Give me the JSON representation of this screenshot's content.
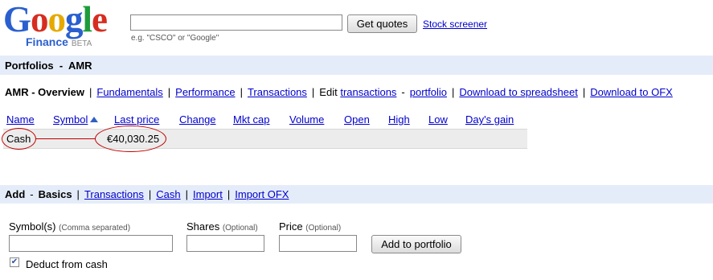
{
  "logo": {
    "letters": [
      "G",
      "o",
      "o",
      "g",
      "l",
      "e"
    ],
    "product": "Finance",
    "badge": "BETA"
  },
  "search": {
    "value": "",
    "hint": "e.g. \"CSCO\" or \"Google\"",
    "button": "Get quotes",
    "screener_link": "Stock screener"
  },
  "portfolio_bar": {
    "title": "Portfolios  -  AMR"
  },
  "overview_nav": {
    "current": "AMR - Overview",
    "fundamentals": "Fundamentals",
    "performance": "Performance",
    "transactions": "Transactions",
    "edit_prefix": "Edit",
    "edit_transactions": "transactions",
    "edit_dash": "-",
    "edit_portfolio": "portfolio",
    "download_spreadsheet": "Download to spreadsheet",
    "download_ofx": "Download to OFX",
    "separator": "|"
  },
  "table": {
    "headers": [
      "Name",
      "Symbol",
      "Last price",
      "Change",
      "Mkt cap",
      "Volume",
      "Open",
      "High",
      "Low",
      "Day's gain"
    ],
    "sort_icon": "triangle-up-icon",
    "rows": [
      {
        "name": "Cash",
        "last_price": "€40,030.25"
      }
    ]
  },
  "add_bar": {
    "title": "Add",
    "dash": "-",
    "current": "Basics",
    "links": [
      "Transactions",
      "Cash",
      "Import",
      "Import OFX"
    ]
  },
  "form": {
    "symbols_label": "Symbol(s)",
    "symbols_hint": "(Comma separated)",
    "symbols_value": "",
    "shares_label": "Shares",
    "shares_hint": "(Optional)",
    "shares_value": "",
    "price_label": "Price",
    "price_hint": "(Optional)",
    "price_value": "",
    "add_button": "Add to portfolio",
    "deduct_label": "Deduct from cash",
    "deduct_checked": true,
    "check_mark": "✔"
  },
  "annotation_color": "#c00000"
}
